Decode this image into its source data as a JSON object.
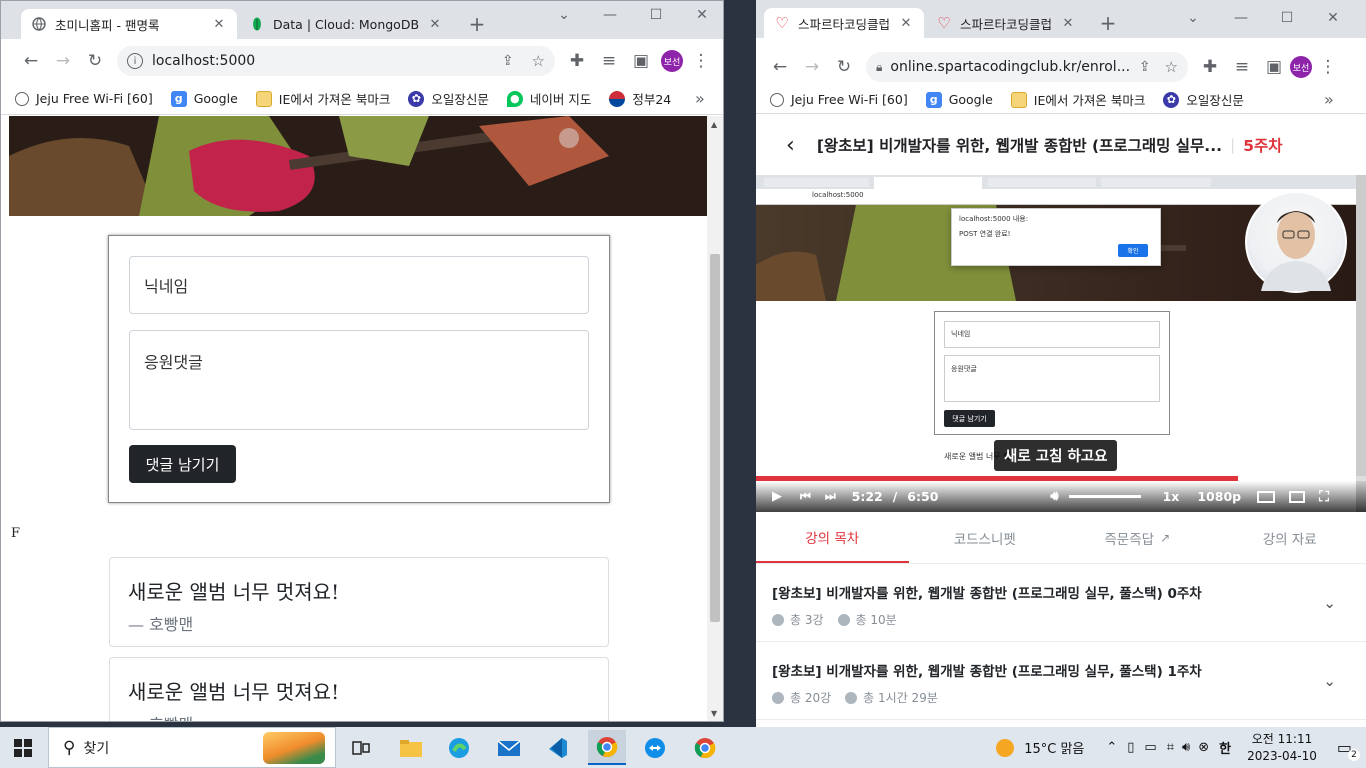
{
  "left_window": {
    "tabs": [
      {
        "title": "초미니홈피 - 팬명록",
        "active": true
      },
      {
        "title": "Data | Cloud: MongoDB Clo",
        "active": false
      }
    ],
    "url": "localhost:5000",
    "profile": "보선",
    "bookmarks": [
      "Jeju Free Wi-Fi [60]",
      "Google",
      "IE에서 가져온 북마크",
      "오일장신문",
      "네이버 지도",
      "정부24"
    ],
    "form": {
      "nickname_placeholder": "닉네임",
      "comment_placeholder": "응원댓글",
      "submit_label": "댓글 남기기"
    },
    "stray_char": "F",
    "comments": [
      {
        "text": "새로운 앨범 너무 멋져요!",
        "author": "— 호빵맨"
      },
      {
        "text": "새로운 앨범 너무 멋져요!",
        "author": "— 호빵맨"
      }
    ]
  },
  "right_window": {
    "tabs": [
      {
        "title": "스파르타코딩클럽",
        "active": true
      },
      {
        "title": "스파르타코딩클럽",
        "active": false
      }
    ],
    "url": "online.spartacodingclub.kr/enrol...",
    "profile": "보선",
    "bookmarks": [
      "Jeju Free Wi-Fi [60]",
      "Google",
      "IE에서 가져온 북마크",
      "오일장신문"
    ],
    "lecture": {
      "title": "[왕초보] 비개발자를 위한, 웹개발 종합반 (프로그래밍 실무...",
      "week": "5주차"
    },
    "video": {
      "inner_url": "localhost:5000",
      "alert_title": "localhost:5000 내용:",
      "alert_message": "POST 연결 완료!",
      "alert_ok": "확인",
      "inner_nickname": "닉네임",
      "inner_comment": "응원댓글",
      "inner_submit": "댓글 남기기",
      "inner_comment_text": "새로운 앨범 너무 멋져요!",
      "subtitle": "새로 고침 하고요",
      "current_time": "5:22",
      "separator": "/",
      "duration": "6:50",
      "speed": "1x",
      "quality": "1080p",
      "progress": 0.79
    },
    "content_tabs": [
      "강의 목차",
      "코드스니펫",
      "즉문즉답",
      "강의 자료"
    ],
    "chapters": [
      {
        "title": "[왕초보] 비개발자를 위한, 웹개발 종합반 (프로그래밍 실무, 풀스택) 0주차",
        "count": "총 3강",
        "time": "총 10분"
      },
      {
        "title": "[왕초보] 비개발자를 위한, 웹개발 종합반 (프로그래밍 실무, 풀스택) 1주차",
        "count": "총 20강",
        "time": "총 1시간 29분"
      }
    ]
  },
  "taskbar": {
    "search_label": "찾기",
    "weather": "15°C  맑음",
    "ime": "한",
    "time": "오전 11:11",
    "date": "2023-04-10",
    "notifications": "2"
  }
}
